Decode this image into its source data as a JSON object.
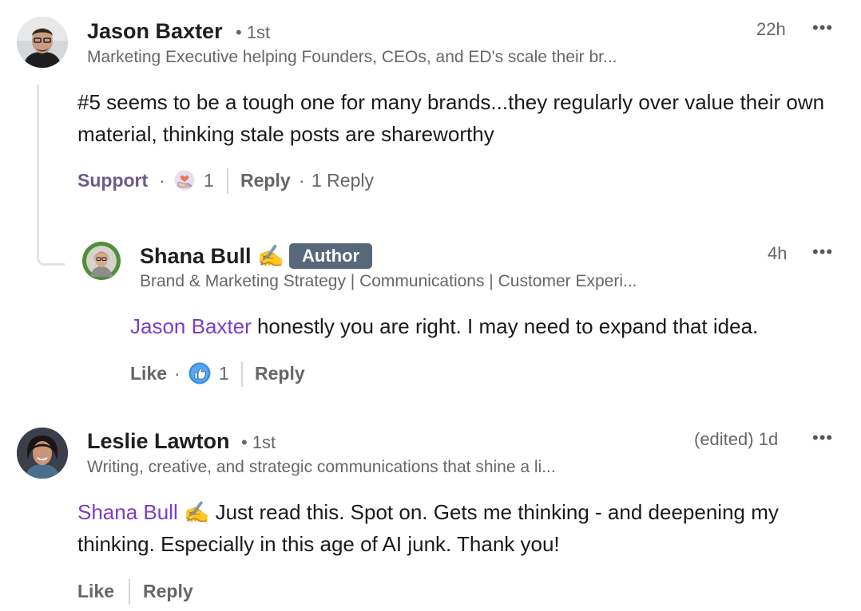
{
  "comments": [
    {
      "author": "Jason Baxter",
      "degree": "• 1st",
      "headline": "Marketing Executive helping Founders, CEOs, and ED's scale their br...",
      "time": "22h",
      "text": "#5 seems to be a tough one for many brands...they regularly over value their own material, thinking stale posts are shareworthy",
      "reaction_label": "Support",
      "reaction_count": "1",
      "reply_label": "Reply",
      "replies_count": "1 Reply",
      "reply": {
        "author": "Shana Bull ✍️",
        "badge": "Author",
        "headline": "Brand & Marketing Strategy | Communications | Customer Experi...",
        "time": "4h",
        "mention": "Jason Baxter",
        "text": " honestly you are right. I may need to expand that idea.",
        "reaction_label": "Like",
        "reaction_count": "1",
        "reply_label": "Reply"
      }
    },
    {
      "author": "Leslie Lawton",
      "degree": "• 1st",
      "headline": "Writing, creative, and strategic communications that shine a li...",
      "time": "(edited) 1d",
      "mention": "Shana Bull ✍️",
      "text": " Just read this. Spot on. Gets me thinking - and deepening my thinking. Especially in this age of AI junk. Thank you!",
      "reaction_label": "Like",
      "reply_label": "Reply"
    }
  ],
  "icons": {
    "support": "support-reaction-icon",
    "like": "like-reaction-icon",
    "more": "more-options-icon"
  },
  "colors": {
    "mention": "#7a3dc8",
    "author_badge": "#56687a",
    "like_blue": "#378fe9"
  }
}
